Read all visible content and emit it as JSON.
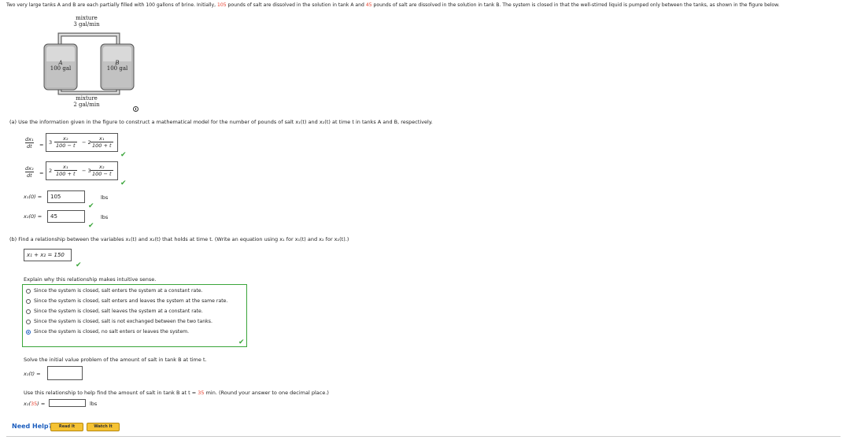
{
  "intro": {
    "part1": "Two very large tanks A and B are each partially filled with 100 gallons of brine. Initially, ",
    "salt_a": "105",
    "part2": " pounds of salt are dissolved in the solution in tank A and ",
    "salt_b": "45",
    "part3": " pounds of salt are dissolved in the solution in tank B. The system is closed in that the well-stirred liquid is pumped only between the tanks, as shown in the figure below."
  },
  "figure": {
    "top_label_1": "mixture",
    "top_label_2": "3 gal/min",
    "tank_a_name": "A",
    "tank_a_vol": "100 gal",
    "tank_b_name": "B",
    "tank_b_vol": "100 gal",
    "bottom_label_1": "mixture",
    "bottom_label_2": "2 gal/min"
  },
  "part_a": {
    "prompt": "(a)  Use the information given in the figure to construct a mathematical model for the number of pounds of salt x₁(t) and x₂(t) at time t in tanks A and B, respectively.",
    "eq1": {
      "lhs_num": "dx₁",
      "lhs_den": "dt",
      "c1": "3",
      "n1": "x₂",
      "d1": "100 − t",
      "op": "− 2",
      "n2": "x₁",
      "d2": "100 + t"
    },
    "eq2": {
      "lhs_num": "dx₂",
      "lhs_den": "dt",
      "c1": "2",
      "n1": "x₁",
      "d1": "100 + t",
      "op": "− 3",
      "n2": "x₂",
      "d2": "100 − t"
    },
    "ic1_label": "x₁(0)  =",
    "ic1_value": "105",
    "ic1_unit": "lbs",
    "ic2_label": "x₂(0)  =",
    "ic2_value": "45",
    "ic2_unit": "lbs"
  },
  "part_b": {
    "prompt": "(b)  Find a relationship between the variables x₁(t) and x₂(t) that holds at time t. (Write an equation using x₁ for x₁(t) and x₂ for x₂(t).)",
    "relation": "x₁ + x₂ = 150",
    "explain_prompt": "Explain why this relationship makes intuitive sense.",
    "options": [
      "Since the system is closed, salt enters the system at a constant rate.",
      "Since the system is closed, salt enters and leaves the system at the same rate.",
      "Since the system is closed, salt leaves the system at a constant rate.",
      "Since the system is closed, salt is not exchanged between the two tanks.",
      "Since the system is closed, no salt enters or leaves the system."
    ],
    "selected_index": 4,
    "ivp_prompt": "Solve the initial value problem of the amount of salt in tank B at time t.",
    "x2t_label": "x₂(t)  =",
    "x2t_value": "",
    "use_prompt_1": "Use this relationship to help find the amount of salt in tank B at t = ",
    "use_t": "35",
    "use_prompt_2": " min. (Round your answer to one decimal place.)",
    "x235_label_1": "x₂(",
    "x235_t": "35",
    "x235_label_2": ")  =",
    "x235_value": "",
    "x235_unit": "lbs"
  },
  "help": {
    "label": "Need Help?",
    "read_it": "Read It",
    "watch_it": "Watch It"
  },
  "colors": {
    "accent_red": "#e8402e",
    "check_green": "#3aa53a",
    "help_blue": "#1d5fbf",
    "button_gold": "#f5c233"
  }
}
